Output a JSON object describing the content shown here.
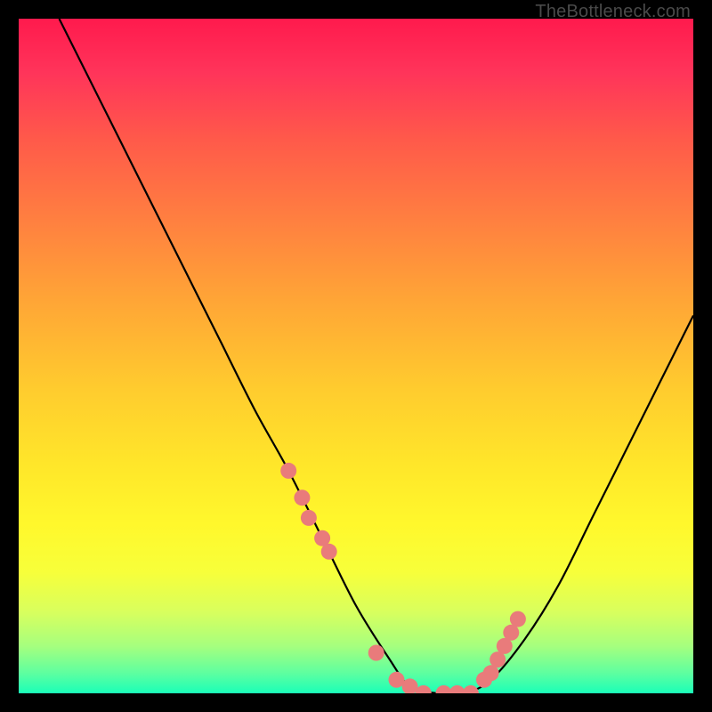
{
  "attribution": "TheBottleneck.com",
  "chart_data": {
    "type": "line",
    "title": "",
    "xlabel": "",
    "ylabel": "",
    "xlim": [
      0,
      100
    ],
    "ylim": [
      0,
      100
    ],
    "series": [
      {
        "name": "bottleneck-curve",
        "x": [
          6,
          10,
          15,
          20,
          25,
          30,
          35,
          40,
          45,
          50,
          55,
          58,
          62,
          66,
          70,
          75,
          80,
          85,
          90,
          95,
          100
        ],
        "y": [
          100,
          92,
          82,
          72,
          62,
          52,
          42,
          33,
          23,
          13,
          5,
          1,
          0,
          0,
          2,
          8,
          16,
          26,
          36,
          46,
          56
        ]
      }
    ],
    "markers": {
      "name": "highlight-dots",
      "color": "#e97b7b",
      "x": [
        40,
        42,
        43,
        45,
        46,
        53,
        56,
        58,
        60,
        63,
        65,
        67,
        69,
        70,
        71,
        72,
        73,
        74
      ],
      "y": [
        33,
        29,
        26,
        23,
        21,
        6,
        2,
        1,
        0,
        0,
        0,
        0,
        2,
        3,
        5,
        7,
        9,
        11
      ]
    },
    "background_gradient": {
      "top": "#ff1a4d",
      "mid": "#ffe62a",
      "bottom": "#1affb8"
    }
  }
}
